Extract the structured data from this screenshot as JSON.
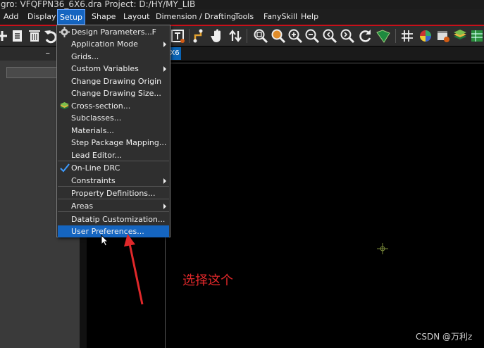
{
  "window": {
    "title": "gro: VFQFPN36_6X6.dra  Project: D:/HY/MY_LIB"
  },
  "menubar": {
    "items": [
      {
        "label": "Add"
      },
      {
        "label": "Display"
      },
      {
        "label": "Setup",
        "active": true
      },
      {
        "label": "Shape"
      },
      {
        "label": "Layout"
      },
      {
        "label": "Dimension / Drafting"
      },
      {
        "label": "Tools"
      },
      {
        "label": "FanySkill"
      },
      {
        "label": "Help"
      }
    ]
  },
  "toolbar": {
    "icons": [
      "add-icon",
      "document-icon",
      "delete-icon",
      "undo-icon",
      "text-icon",
      "route-icon",
      "hand-icon",
      "swap-icon",
      "zoom-fit-icon",
      "zoom-window-icon",
      "zoom-in-icon",
      "zoom-out-icon",
      "zoom-previous-icon",
      "refresh-icon",
      "map-icon",
      "grid-icon",
      "color-icon",
      "window-icon",
      "layers-icon",
      "table-icon"
    ]
  },
  "canvas": {
    "tab_label": "X6"
  },
  "setup_menu": {
    "items": [
      {
        "label": "Design Parameters...",
        "shortcut": "F",
        "icon": "settings-icon"
      },
      {
        "label": "Application Mode",
        "submenu": true
      },
      {
        "label": "Grids..."
      },
      {
        "label": "Custom Variables",
        "submenu": true
      },
      {
        "label": "Change Drawing Origin"
      },
      {
        "label": "Change Drawing Size..."
      },
      {
        "label": "Cross-section...",
        "icon": "cross-section-icon"
      },
      {
        "label": "Subclasses..."
      },
      {
        "label": "Materials..."
      },
      {
        "label": "Step Package Mapping..."
      },
      {
        "label": "Lead Editor..."
      },
      {
        "label": "On-Line DRC",
        "checked": true
      },
      {
        "label": "Constraints",
        "submenu": true
      },
      {
        "label": "Property Definitions..."
      },
      {
        "label": "Areas",
        "submenu": true
      },
      {
        "label": "Datatip Customization..."
      },
      {
        "label": "User Preferences...",
        "highlighted": true
      }
    ]
  },
  "annotation": {
    "text": "选择这个",
    "color": "#e0282a"
  },
  "watermark": {
    "text": "CSDN @万利z"
  },
  "colors": {
    "menu_accent": "#1565c0",
    "toolbar_border": "#c8101a",
    "annotation": "#e0282a"
  }
}
